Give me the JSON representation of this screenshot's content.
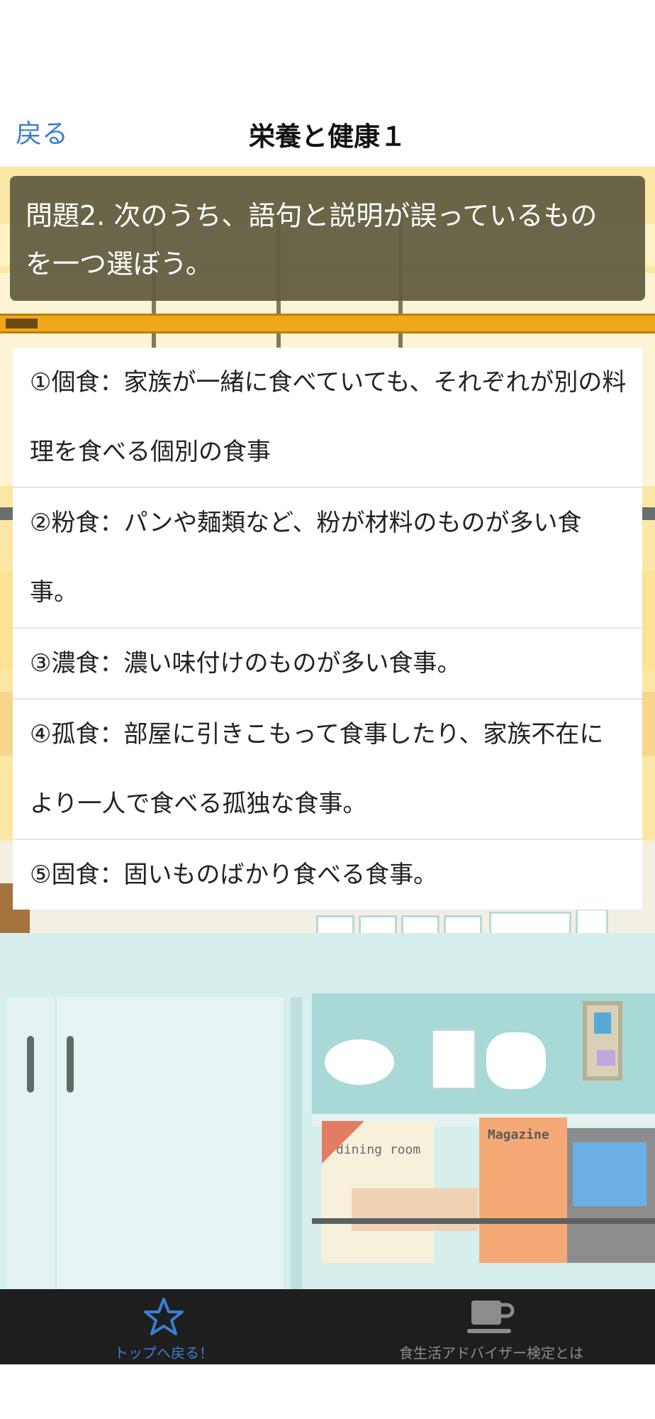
{
  "nav": {
    "back_label": "戻る",
    "title": "栄養と健康１"
  },
  "question": {
    "text": "問題2. 次のうち、語句と説明が誤っているものを一つ選ぼう。"
  },
  "timer": {
    "remaining_fraction": 0.05
  },
  "answers": [
    {
      "label": "①個食：家族が一緒に食べていても、それぞれが別の料理を食べる個別の食事"
    },
    {
      "label": "②粉食：パンや麺類など、粉が材料のものが多い食事。"
    },
    {
      "label": "③濃食：濃い味付けのものが多い食事。"
    },
    {
      "label": "④孤食：部屋に引きこもって食事したり、家族不在により一人で食べる孤独な食事。"
    },
    {
      "label": "⑤固食：固いものばかり食べる食事。"
    }
  ],
  "scene": {
    "book_left_label": "dining room",
    "book_right_label": "Magazine"
  },
  "tabbar": {
    "tabs": [
      {
        "label": "トップへ戻る！",
        "icon": "star-icon",
        "color": "#3a7fd0"
      },
      {
        "label": "食生活アドバイザー検定とは",
        "icon": "coffee-cup-icon",
        "color": "#8c8c8c"
      }
    ]
  },
  "colors": {
    "accent": "#3a7fd0",
    "question_bg": "#635e42",
    "progress": "#f0a81a",
    "tabbar_bg": "#1e1e1e"
  }
}
